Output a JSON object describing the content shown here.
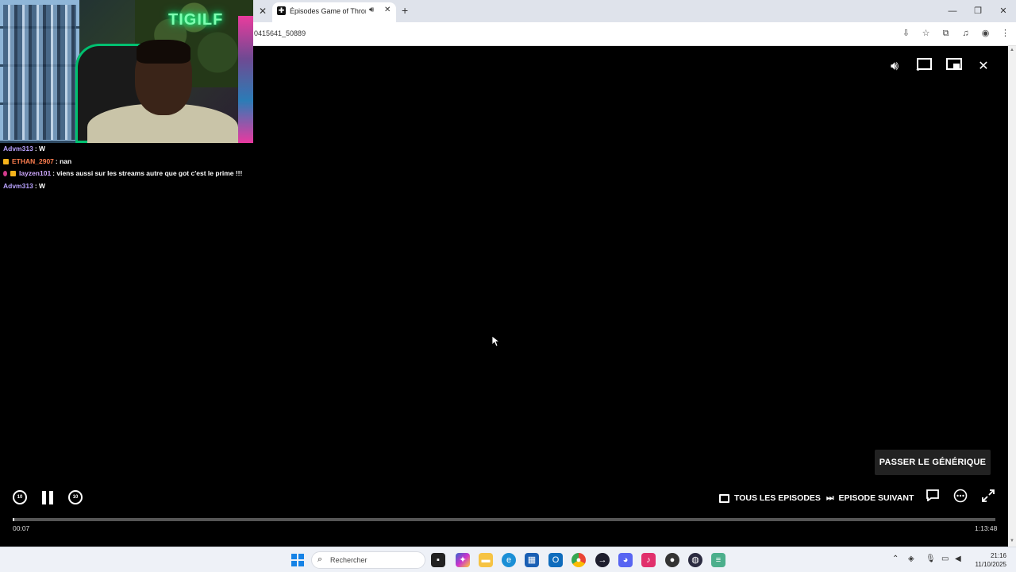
{
  "webcam": {
    "neon_sign": "TIGILF"
  },
  "chat": [
    {
      "user": "Advm313",
      "user_color": "#b9a3ff",
      "badges": [],
      "message": " : W"
    },
    {
      "user": "ETHAN_2907",
      "user_color": "#ff7f50",
      "badges": [
        "crown"
      ],
      "message": " : nan"
    },
    {
      "user": "layzen101",
      "user_color": "#cfa8ff",
      "badges": [
        "drop",
        "crown"
      ],
      "message": " : viens aussi sur les streams autre que got c'est le prime !!!"
    },
    {
      "user": "Advm313",
      "user_color": "#b9a3ff",
      "badges": [],
      "message": " : W"
    }
  ],
  "browser": {
    "tab_title": "Épisodes Game of Thrones",
    "url": "0415641_50889",
    "tab_audio_icon": "speaker-icon",
    "address_icons": [
      "install-app-icon",
      "bookmark-star-icon",
      "extensions-icon",
      "media-control-icon",
      "profile-icon",
      "menu-icon"
    ]
  },
  "player": {
    "skip_button": "PASSER LE GÉNÉRIQUE",
    "all_episodes": "TOUS LES EPISODES",
    "next_episode": "EPISODE SUIVANT",
    "seek_back": "10",
    "seek_forward": "10",
    "current_time": "00:07",
    "total_time": "1:13:48",
    "progress_fraction": 0.0016
  },
  "taskbar": {
    "search_placeholder": "Rechercher",
    "time": "21:16",
    "date": "11/10/2025"
  },
  "colors": {
    "accent": "#0a74d8",
    "player_bg": "#000000",
    "skip_bg": "#222222"
  }
}
